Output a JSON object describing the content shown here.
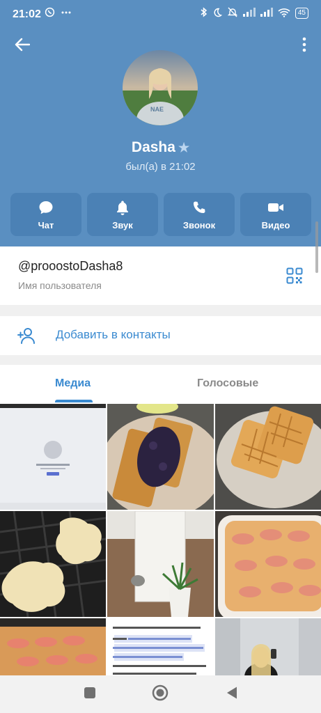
{
  "status_bar": {
    "time": "21:02",
    "battery": "45"
  },
  "profile": {
    "name": "Dasha",
    "last_seen": "был(а) в 21:02"
  },
  "actions": [
    {
      "label": "Чат",
      "icon": "chat-icon"
    },
    {
      "label": "Звук",
      "icon": "bell-icon"
    },
    {
      "label": "Звонок",
      "icon": "phone-icon"
    },
    {
      "label": "Видео",
      "icon": "video-camera-icon"
    }
  ],
  "info": {
    "username": "@prooostoDasha8",
    "username_caption": "Имя пользователя"
  },
  "add_contact": {
    "label": "Добавить в контакты"
  },
  "tabs": {
    "media": "Медиа",
    "voice": "Голосовые"
  },
  "colors": {
    "header": "#5a8fc1",
    "action_bg": "#4b81b5",
    "accent": "#3a8ad0"
  }
}
